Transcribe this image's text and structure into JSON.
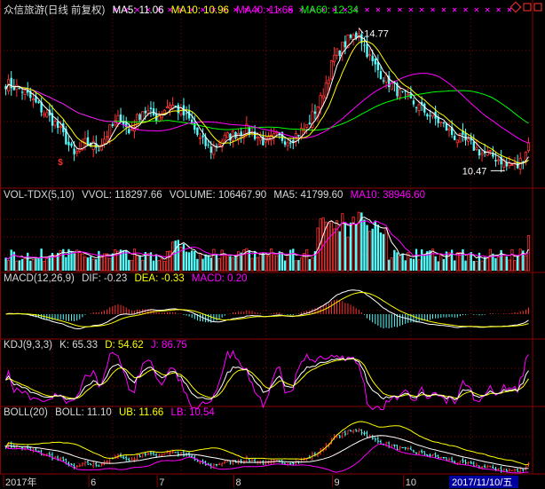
{
  "panels": {
    "price": {
      "title": "众信旅游(日线 前复权)",
      "items": [
        {
          "label": "MA5: 11.06",
          "color": "#ffffff"
        },
        {
          "label": "MA10: 10.96",
          "color": "#ffff00"
        },
        {
          "label": "MA40: 11.66",
          "color": "#ff00ff"
        },
        {
          "label": "MA60: 12.34",
          "color": "#00ff00"
        }
      ],
      "high_label": "14.77",
      "low_label": "10.47"
    },
    "vol": {
      "title": "VOL-TDX(5,10)",
      "items": [
        {
          "label": "VVOL: 118297.66",
          "color": "#ffffff"
        },
        {
          "label": "VOLUME: 106467.90",
          "color": "#ffffff"
        },
        {
          "label": "MA5: 41799.60",
          "color": "#ffffff"
        },
        {
          "label": "MA10: 38946.60",
          "color": "#ff00ff"
        }
      ]
    },
    "macd": {
      "title": "MACD(12,26,9)",
      "items": [
        {
          "label": "DIF: -0.23",
          "color": "#ffffff"
        },
        {
          "label": "DEA: -0.33",
          "color": "#ffff00"
        },
        {
          "label": "MACD: 0.20",
          "color": "#ff00ff"
        }
      ]
    },
    "kdj": {
      "title": "KDJ(9,3,3)",
      "items": [
        {
          "label": "K: 65.33",
          "color": "#ffffff"
        },
        {
          "label": "D: 54.62",
          "color": "#ffff00"
        },
        {
          "label": "J: 86.75",
          "color": "#ff00ff"
        }
      ]
    },
    "boll": {
      "title": "BOLL(20)",
      "items": [
        {
          "label": "BOLL: 11.10",
          "color": "#ffffff"
        },
        {
          "label": "UB: 11.66",
          "color": "#ffff00"
        },
        {
          "label": "LB: 10.54",
          "color": "#ff00ff"
        }
      ]
    }
  },
  "date_axis": {
    "labels": [
      "2017年",
      "6",
      "7",
      "8",
      "9",
      "10"
    ],
    "cursor_date": "2017/11/10/五"
  },
  "colors": {
    "up": "#ff3232",
    "down": "#54ffff",
    "grid": "#8b0000",
    "text": "#d8d8d8"
  },
  "chart_data": {
    "type": "candlestick",
    "title": "众信旅游(日线 前复权)",
    "ylim": [
      10.0,
      15.0
    ],
    "key_points": {
      "high": 14.77,
      "low": 10.47
    },
    "ma": {
      "MA5": 11.06,
      "MA10": 10.96,
      "MA40": 11.66,
      "MA60": 12.34
    },
    "close_anchors": [
      [
        0,
        13.1
      ],
      [
        6,
        12.9
      ],
      [
        12,
        12.4
      ],
      [
        18,
        11.9
      ],
      [
        22,
        11.4
      ],
      [
        25,
        10.9
      ],
      [
        29,
        11.3
      ],
      [
        34,
        11.2
      ],
      [
        38,
        11.7
      ],
      [
        42,
        12.1
      ],
      [
        45,
        11.6
      ],
      [
        50,
        12.3
      ],
      [
        55,
        12.1
      ],
      [
        60,
        12.5
      ],
      [
        63,
        12.3
      ],
      [
        67,
        12.0
      ],
      [
        71,
        11.4
      ],
      [
        75,
        11.1
      ],
      [
        79,
        11.4
      ],
      [
        84,
        11.6
      ],
      [
        88,
        11.7
      ],
      [
        92,
        11.5
      ],
      [
        95,
        11.3
      ],
      [
        99,
        11.5
      ],
      [
        103,
        11.4
      ],
      [
        107,
        11.6
      ],
      [
        110,
        11.8
      ],
      [
        115,
        12.6
      ],
      [
        120,
        13.9
      ],
      [
        125,
        14.4
      ],
      [
        129,
        14.6
      ],
      [
        134,
        13.7
      ],
      [
        139,
        13.2
      ],
      [
        144,
        12.8
      ],
      [
        149,
        12.5
      ],
      [
        154,
        12.2
      ],
      [
        159,
        11.9
      ],
      [
        164,
        11.5
      ],
      [
        169,
        11.3
      ],
      [
        174,
        11.0
      ],
      [
        178,
        10.9
      ],
      [
        183,
        10.7
      ],
      [
        187,
        10.6
      ],
      [
        189,
        10.9
      ],
      [
        191,
        11.3
      ]
    ]
  }
}
